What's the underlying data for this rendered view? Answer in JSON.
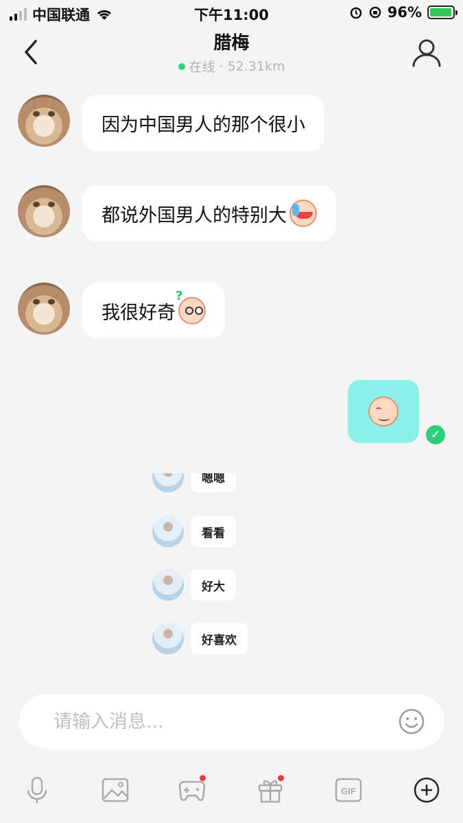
{
  "status_bar": {
    "carrier": "中国联通",
    "time": "下午11:00",
    "battery_percent": "96%",
    "battery_level": 0.96
  },
  "header": {
    "title": "腊梅",
    "status": "在线",
    "separator": "·",
    "distance": "52.31km"
  },
  "messages": [
    {
      "direction": "received",
      "text": "因为中国男人的那个很小"
    },
    {
      "direction": "received",
      "text": "都说外国男人的特别大",
      "emoji": "crying-laugh-emoji"
    },
    {
      "direction": "received",
      "text": "我很好奇",
      "emoji": "wondering-emoji"
    },
    {
      "direction": "sent",
      "emoji": "smiling-face-emoji",
      "read": true
    }
  ],
  "embedded_screenshot": {
    "items": [
      "嗯嗯",
      "看看",
      "好大",
      "好喜欢"
    ]
  },
  "composer": {
    "placeholder": "请输入消息..."
  },
  "toolbar": {
    "gif_label": "GIF",
    "icons": [
      "microphone-icon",
      "image-icon",
      "game-icon",
      "gift-icon",
      "gif-icon",
      "plus-icon"
    ]
  },
  "colors": {
    "online": "#2dcf7a",
    "sent_bubble": "#8af0e8",
    "notification_dot": "#f23a3a"
  }
}
